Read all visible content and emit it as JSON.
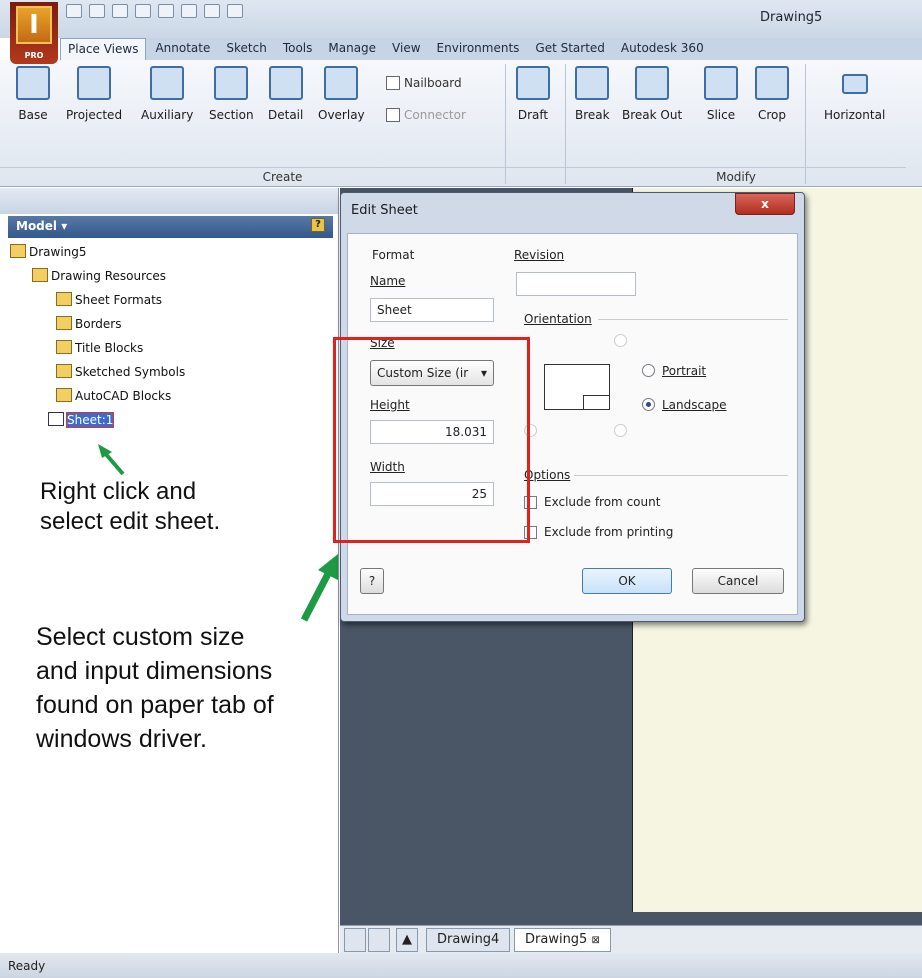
{
  "window": {
    "document_title": "Drawing5",
    "app_badge": "PRO"
  },
  "ribbon_tabs": [
    "Place Views",
    "Annotate",
    "Sketch",
    "Tools",
    "Manage",
    "View",
    "Environments",
    "Get Started",
    "Autodesk 360"
  ],
  "ribbon": {
    "create_tools": [
      "Base",
      "Projected",
      "Auxiliary",
      "Section",
      "Detail",
      "Overlay"
    ],
    "nailboard": "Nailboard",
    "connector": "Connector",
    "draft": "Draft",
    "modify_tools": [
      "Break",
      "Break Out",
      "Slice",
      "Crop"
    ],
    "horizontal": "Horizontal",
    "group_create": "Create",
    "group_modify": "Modify"
  },
  "browser": {
    "header": "Model ▾",
    "help": "?",
    "tree": [
      {
        "label": "Drawing5",
        "level": 0
      },
      {
        "label": "Drawing Resources",
        "level": 1
      },
      {
        "label": "Sheet Formats",
        "level": 2
      },
      {
        "label": "Borders",
        "level": 2
      },
      {
        "label": "Title Blocks",
        "level": 2
      },
      {
        "label": "Sketched Symbols",
        "level": 2
      },
      {
        "label": "AutoCAD Blocks",
        "level": 2
      },
      {
        "label": "Sheet:1",
        "level": 1,
        "selected": true
      }
    ]
  },
  "annotations": {
    "note1_line1": "Right click and",
    "note1_line2": "select edit sheet.",
    "note2_line1": "Select custom size",
    "note2_line2": "and input dimensions",
    "note2_line3": "found on paper tab of",
    "note2_line4": "windows driver."
  },
  "dialog": {
    "title": "Edit Sheet",
    "close": "x",
    "format_label": "Format",
    "name_label": "Name",
    "name_value": "Sheet",
    "size_label": "Size",
    "size_value": "Custom Size (ir",
    "height_label": "Height",
    "height_value": "18.031",
    "width_label": "Width",
    "width_value": "25",
    "revision_label": "Revision",
    "revision_value": "",
    "orientation_label": "Orientation",
    "portrait": "Portrait",
    "landscape": "Landscape",
    "orientation_selected": "Landscape",
    "options_label": "Options",
    "exclude_count": "Exclude from count",
    "exclude_printing": "Exclude from printing",
    "ok": "OK",
    "cancel": "Cancel",
    "help": "?"
  },
  "doc_tabs": [
    "Drawing4",
    "Drawing5"
  ],
  "status": "Ready",
  "colors": {
    "highlight_box": "#e0221c",
    "arrow": "#1e9a44",
    "selection": "#3c6bd0"
  }
}
